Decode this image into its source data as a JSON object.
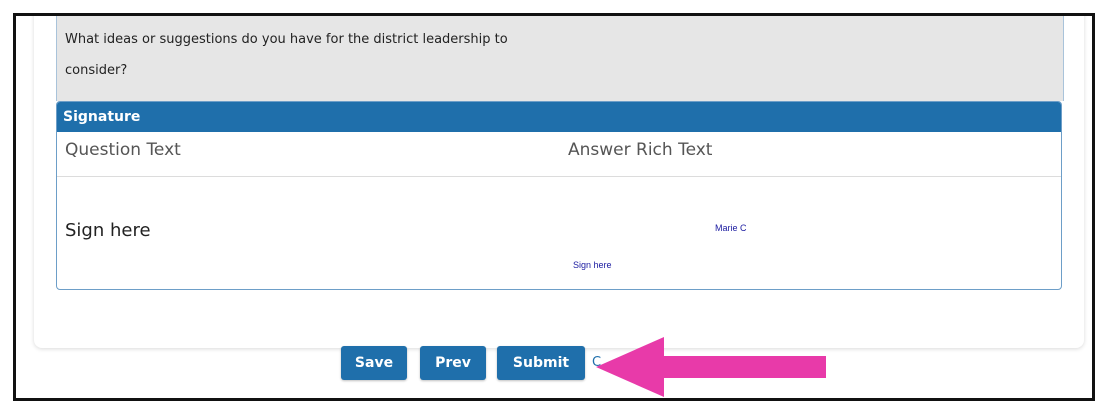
{
  "form": {
    "question_line1": "What ideas or suggestions do you have for the district leadership to",
    "question_line2": "consider?"
  },
  "signature": {
    "header": "Signature",
    "col_question": "Question Text",
    "col_answer": "Answer Rich Text",
    "row_label": "Sign here",
    "signed_name": "Marie C",
    "signature_caption": "Sign here"
  },
  "buttons": {
    "save": "Save",
    "prev": "Prev",
    "submit": "Submit"
  },
  "colors": {
    "primary": "#1f6fab",
    "annotation_arrow": "#e83aa9"
  },
  "icons": {
    "annotation": "arrow-left"
  }
}
